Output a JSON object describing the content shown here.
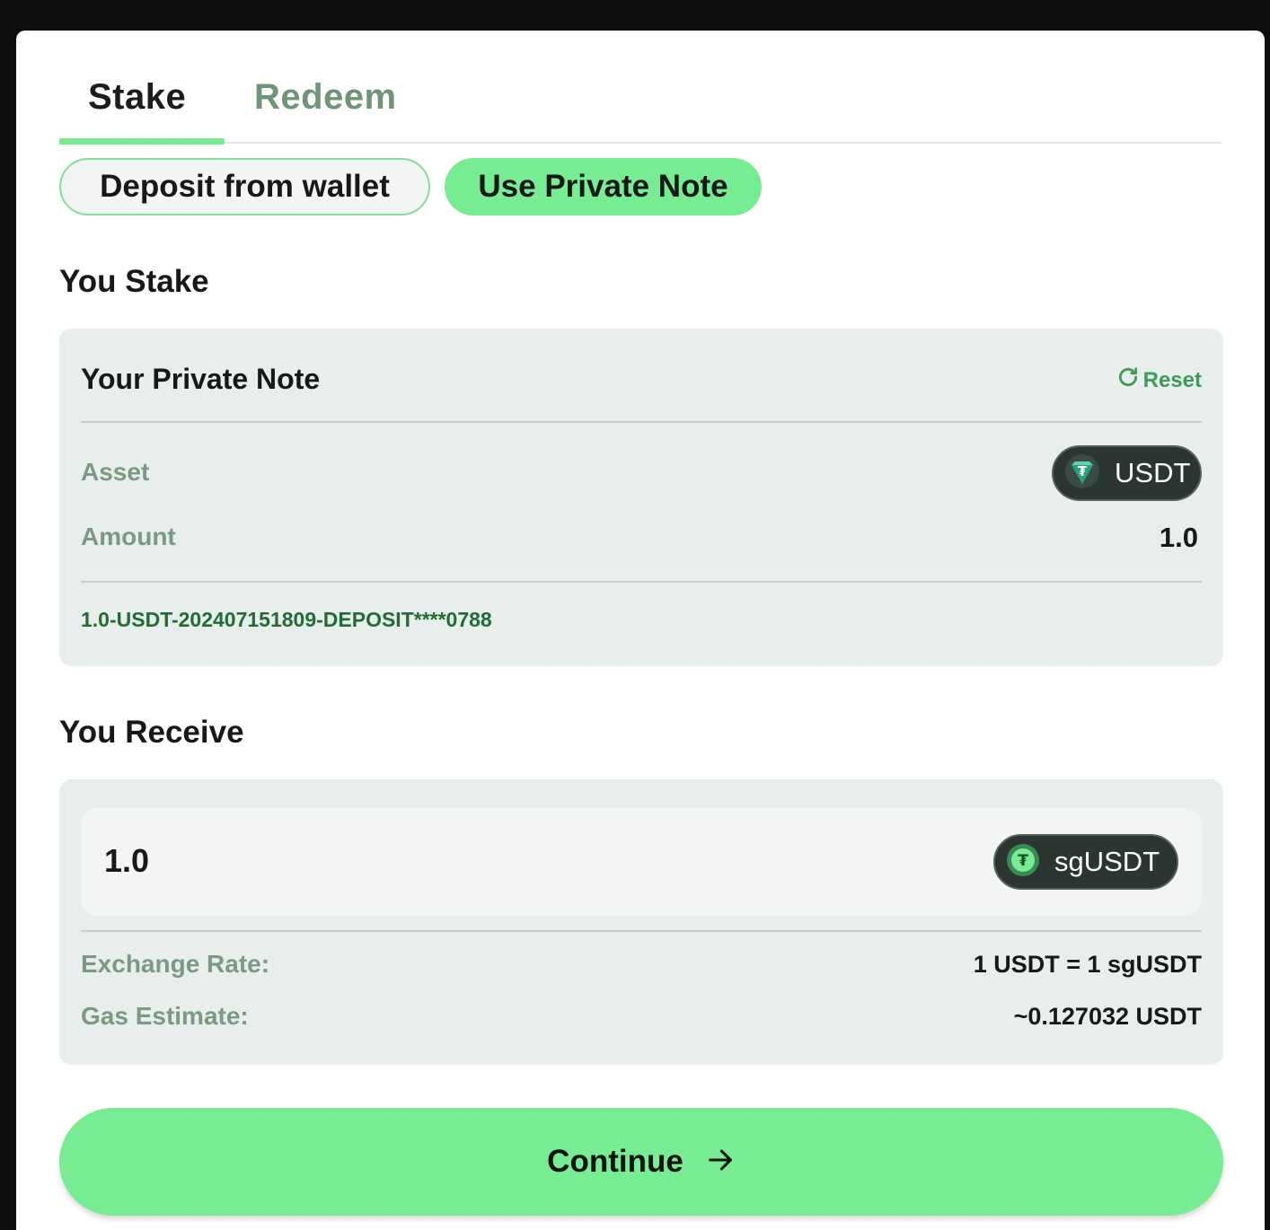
{
  "tabs": {
    "stake": "Stake",
    "redeem": "Redeem",
    "active": "Stake"
  },
  "mode": {
    "deposit_from_wallet": "Deposit from wallet",
    "use_private_note": "Use Private Note",
    "selected": "Use Private Note"
  },
  "you_stake": {
    "title": "You Stake",
    "note_title": "Your Private Note",
    "reset_label": "Reset",
    "asset_label": "Asset",
    "asset_token": "USDT",
    "amount_label": "Amount",
    "amount_value": "1.0",
    "note_id": "1.0-USDT-202407151809-DEPOSIT****0788"
  },
  "you_receive": {
    "title": "You Receive",
    "amount": "1.0",
    "token": "sgUSDT",
    "exchange_rate_label": "Exchange Rate:",
    "exchange_rate_value": "1 USDT = 1 sgUSDT",
    "gas_estimate_label": "Gas Estimate:",
    "gas_estimate_value": "~0.127032 USDT"
  },
  "continue_label": "Continue",
  "icons": {
    "reset": "refresh-icon",
    "usdt": "usdt-token-icon",
    "sgusdt": "sgusdt-token-icon",
    "continue": "arrow-right-icon"
  },
  "colors": {
    "accent": "#77ec92",
    "muted_green": "#6f9579",
    "note_id": "#236b34",
    "panel": "#e8eeeb",
    "pill": "#2c3631"
  }
}
